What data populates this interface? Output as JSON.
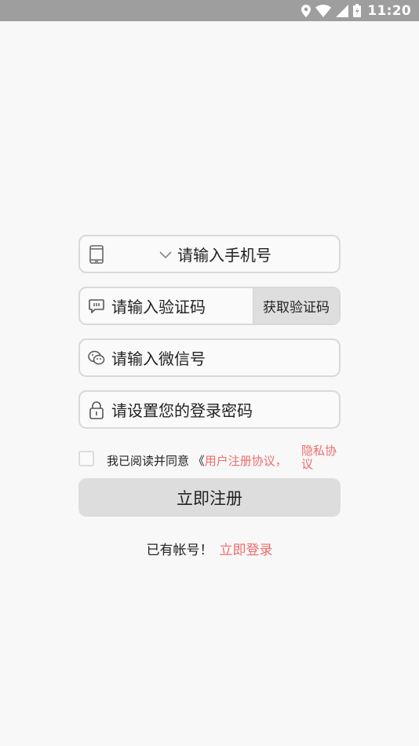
{
  "status_bar": {
    "time": "11:20",
    "icons": [
      "location-icon",
      "wifi-icon",
      "signal-icon",
      "battery-icon"
    ]
  },
  "form": {
    "phone_placeholder": "请输入手机号",
    "code_placeholder": "请输入验证码",
    "get_code_label": "获取验证码",
    "wechat_placeholder": "请输入微信号",
    "password_placeholder": "请设置您的登录密码"
  },
  "agreement": {
    "checked": false,
    "prefix": "我已阅读并同意 《",
    "user_agreement": "用户注册协议，",
    "privacy_policy": "隐私协议"
  },
  "register_label": "立即注册",
  "login": {
    "prompt": "已有帐号！",
    "link": "立即登录"
  },
  "colors": {
    "accent": "#f06b6b",
    "status_bar": "#9e9e9e",
    "button_bg": "#dddddd",
    "field_border": "#d9d9d9"
  }
}
